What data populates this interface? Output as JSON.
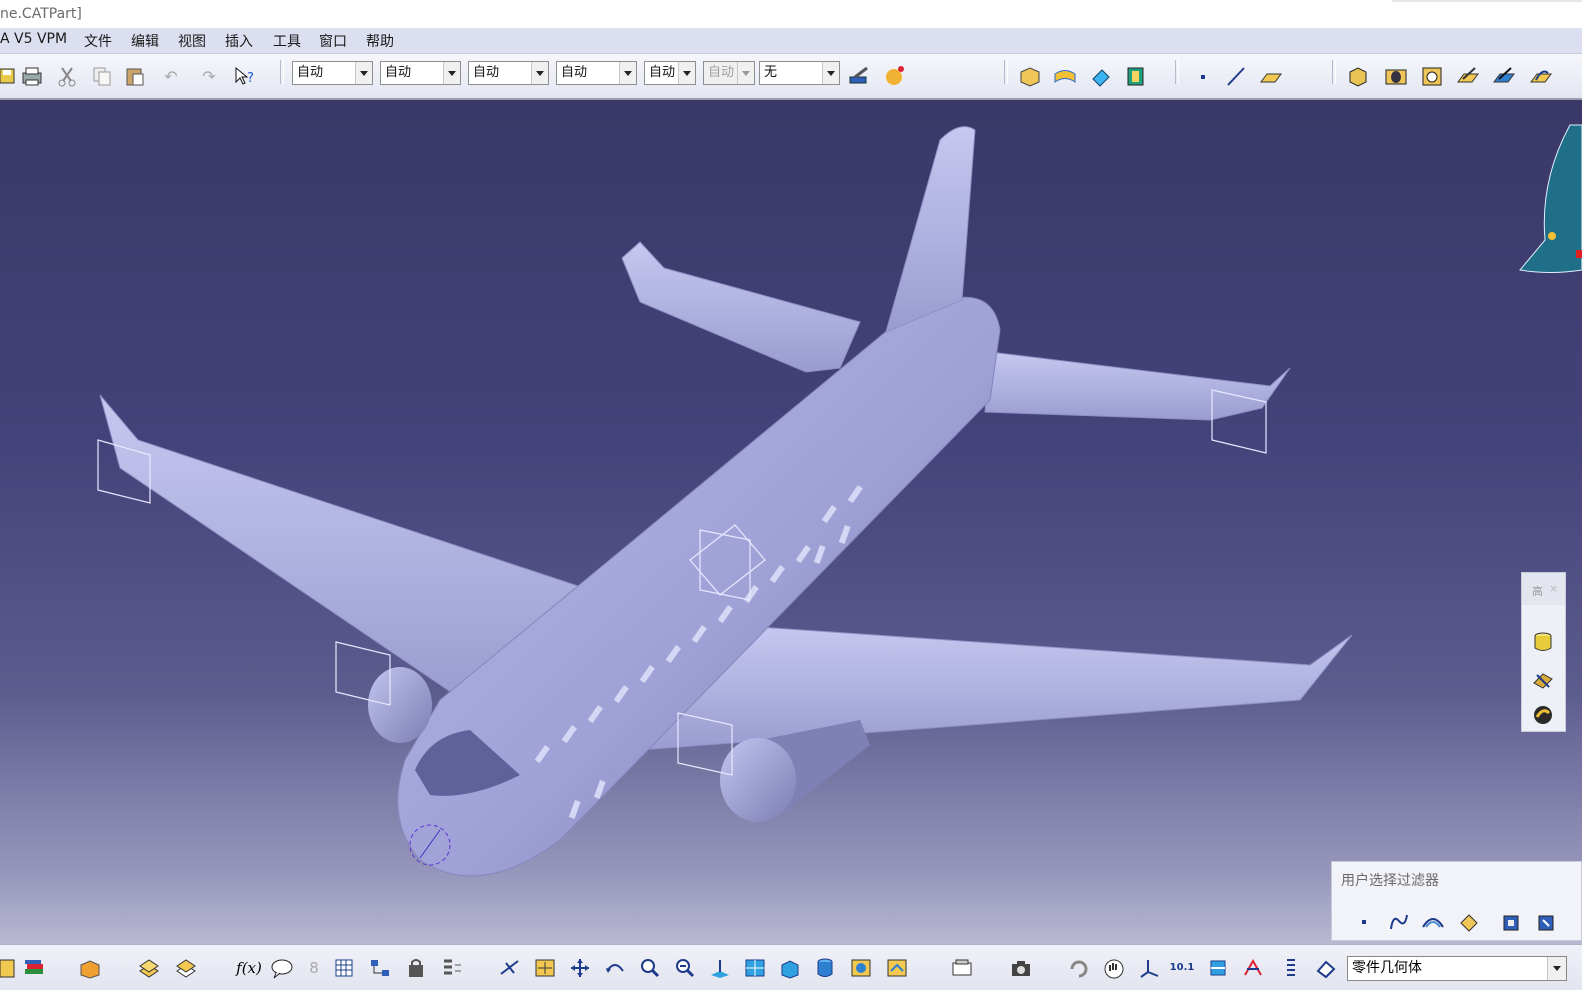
{
  "window": {
    "title": "ne.CATPart]"
  },
  "menu": {
    "items": [
      "A V5 VPM",
      "文件",
      "编辑",
      "视图",
      "插入",
      "工具",
      "窗口",
      "帮助"
    ]
  },
  "toolbar": {
    "icons": [
      "save-icon",
      "print-icon",
      "cut-icon",
      "copy-icon",
      "paste-icon",
      "undo-icon",
      "redo-icon",
      "whats-this-icon"
    ],
    "combos": [
      {
        "value": "自动",
        "disabled": false
      },
      {
        "value": "自动",
        "disabled": false
      },
      {
        "value": "自动",
        "disabled": false
      },
      {
        "value": "自动",
        "disabled": false
      },
      {
        "value": "自动",
        "disabled": false
      },
      {
        "value": "自动",
        "disabled": true
      },
      {
        "value": "无",
        "disabled": false
      }
    ],
    "truncated_combos": {
      "c5": "自动",
      "c6": "自动"
    },
    "right_icons": [
      "painter-icon",
      "apply-material-icon",
      "part-body-icon",
      "surface-icon",
      "eraser-icon",
      "catalog-icon",
      "point-icon",
      "line-icon",
      "plane-icon",
      "pad-icon",
      "hole-icon",
      "pocket-icon",
      "sketch-icon",
      "pen-icon",
      "fillet-icon"
    ]
  },
  "viewport": {
    "background_top": "#3a3867",
    "background_bottom": "#b8b8d2",
    "model_color": "#b4b6e6",
    "model_shadow": "#7d7fb6"
  },
  "right_panel": {
    "header": "高",
    "icons": [
      "cylinder-icon",
      "sweep-icon",
      "analysis-icon"
    ]
  },
  "filter_panel": {
    "title": "用户选择过滤器",
    "icons": [
      "point-filter-icon",
      "curve-filter-icon",
      "surface-filter-icon",
      "volume-filter-icon",
      "feature-filter-icon",
      "geometry-filter-icon"
    ]
  },
  "bottom": {
    "icons": [
      "sketch-icon",
      "books-icon",
      "box-icon",
      "layers-icon",
      "layers2-icon",
      "formula-icon",
      "comment-icon",
      "lock-icon",
      "table-icon",
      "tree-icon",
      "knowledge-icon",
      "list-icon",
      "fly-icon",
      "fit-all-icon",
      "pan-icon",
      "rotate-icon",
      "zoom-in-icon",
      "zoom-out-icon",
      "normal-view-icon",
      "multi-view-icon",
      "iso-view-icon",
      "shading-icon",
      "hide-show-icon",
      "swap-icon",
      "camera-icon",
      "capture-icon",
      "refresh-icon",
      "hand-icon",
      "axis-icon",
      "units-icon",
      "section-icon",
      "compass-icon",
      "measure-icon",
      "tag-icon"
    ],
    "combo_value": "零件几何体",
    "formula_label": "f(x)",
    "scale_label": "10.1"
  }
}
